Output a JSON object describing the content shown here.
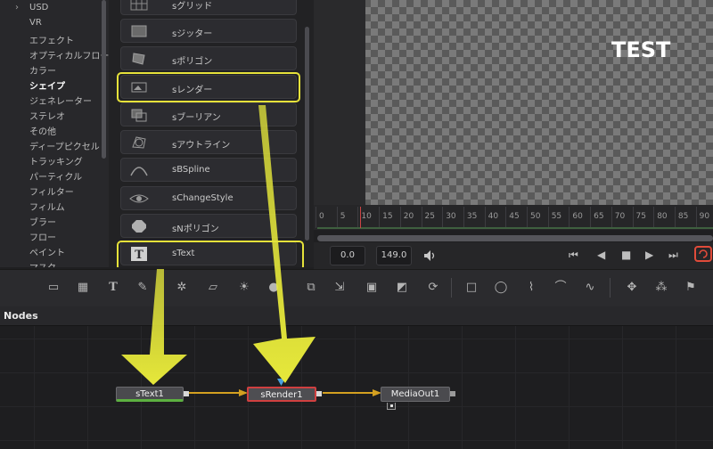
{
  "categories": {
    "items": [
      {
        "label": "USD",
        "expandable": true
      },
      {
        "label": "VR"
      },
      {
        "label": "エフェクト"
      },
      {
        "label": "オプティカルフロー"
      },
      {
        "label": "カラー"
      },
      {
        "label": "シェイプ",
        "selected": true
      },
      {
        "label": "ジェネレーター"
      },
      {
        "label": "ステレオ"
      },
      {
        "label": "その他"
      },
      {
        "label": "ディープピクセル"
      },
      {
        "label": "トラッキング"
      },
      {
        "label": "パーティクル"
      },
      {
        "label": "フィルター"
      },
      {
        "label": "フィルム"
      },
      {
        "label": "ブラー"
      },
      {
        "label": "フロー"
      },
      {
        "label": "ペイント"
      },
      {
        "label": "マスク"
      }
    ]
  },
  "tools": {
    "items": [
      {
        "label": "sグリッド",
        "icon": "grid-icon"
      },
      {
        "label": "sジッター",
        "icon": "jitter-icon"
      },
      {
        "label": "sポリゴン",
        "icon": "polygon-icon"
      },
      {
        "label": "sレンダー",
        "icon": "render-icon",
        "highlighted": true
      },
      {
        "label": "sブーリアン",
        "icon": "boolean-icon"
      },
      {
        "label": "sアウトライン",
        "icon": "outline-icon"
      },
      {
        "label": "sBSpline",
        "icon": "bspline-icon"
      },
      {
        "label": "sChangeStyle",
        "icon": "changestyle-icon"
      },
      {
        "label": "sNポリゴン",
        "icon": "npolygon-icon"
      },
      {
        "label": "sText",
        "icon": "text-icon",
        "highlighted": true
      }
    ]
  },
  "viewer": {
    "overlay_text": "TEST"
  },
  "timeline": {
    "ticks": [
      "0",
      "5",
      "10",
      "15",
      "20",
      "25",
      "30",
      "35",
      "40",
      "45",
      "50",
      "55",
      "60",
      "65",
      "70",
      "75",
      "80",
      "85",
      "90"
    ],
    "playhead_frame": 10
  },
  "transport": {
    "current_time": "0.0",
    "end_time": "149.0"
  },
  "nodes": {
    "title": "Nodes",
    "list": [
      {
        "id": "sText1",
        "label": "sText1"
      },
      {
        "id": "sRender1",
        "label": "sRender1"
      },
      {
        "id": "MediaOut1",
        "label": "MediaOut1"
      }
    ]
  },
  "colors": {
    "highlight": "#e6e23a",
    "arrow": "#e6e83a",
    "link": "#d4a020",
    "loop_accent": "#e04b3a",
    "node_selected_border": "#d04040",
    "text_node_underline": "#5cb040"
  }
}
